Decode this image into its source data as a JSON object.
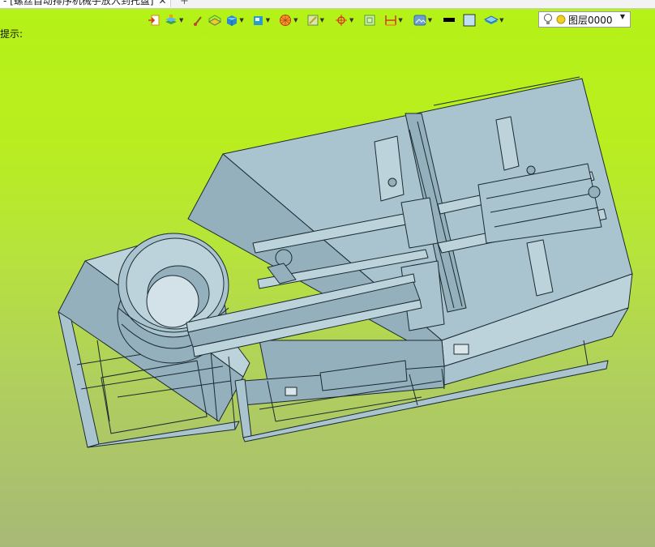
{
  "window": {
    "tab_title": "- [螺丝自动排序机械手放入到托盘]",
    "tab_close": "✕",
    "tab_add": "+"
  },
  "toolbar": {
    "items": [
      "import-icon",
      "layers-icon",
      "brush-icon",
      "box-edges-icon",
      "solid-cube-icon",
      "view-cube-icon",
      "wireframe-sphere-icon",
      "section-icon",
      "snap-icon",
      "frame-icon",
      "dimension-icon",
      "render-icon",
      "line-color-swatch",
      "fill-color-swatch",
      "layer-stack-icon"
    ],
    "line_color": "#000000",
    "fill_color": "#bfe0f0"
  },
  "layer_selector": {
    "value": "图层0000",
    "caret": "▼"
  },
  "status": {
    "hint": "提示:"
  },
  "viewport": {
    "background_top": "#b4f217",
    "background_bottom": "#a7b976",
    "model_fill": "#a9c4cf",
    "model_stroke": "#1c2a30"
  }
}
